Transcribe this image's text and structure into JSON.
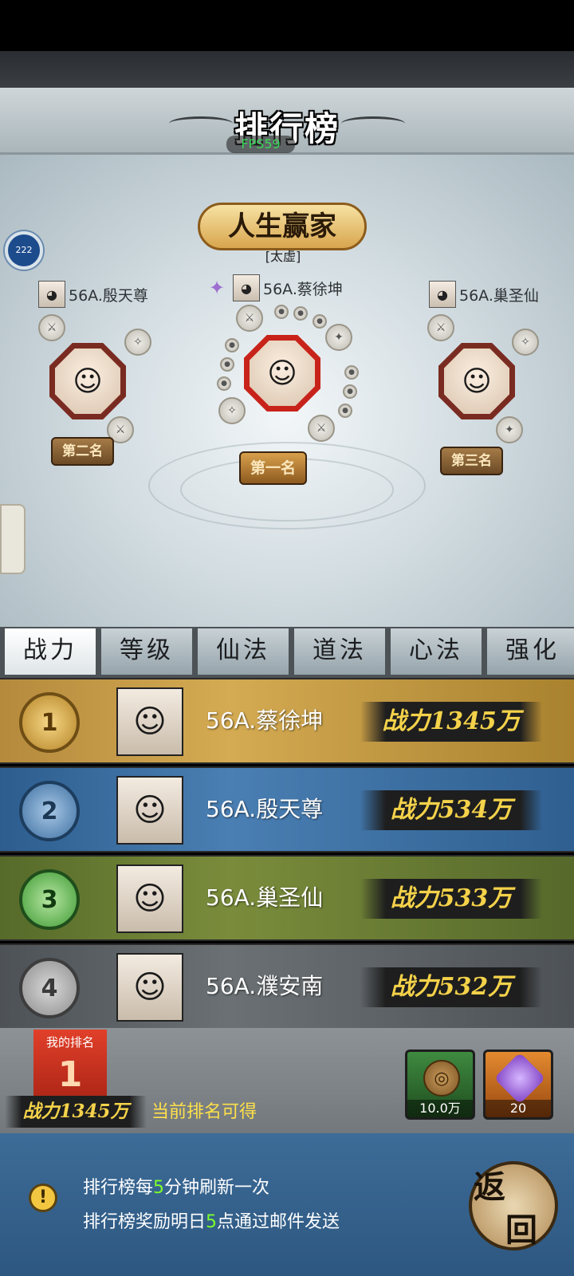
{
  "header": {
    "title": "排行榜",
    "fps": "FPS59"
  },
  "floating_ball": {
    "label": "222"
  },
  "podium": {
    "banner": "人生赢家",
    "subtitle": "[太虚]",
    "first": {
      "name": "56A.蔡徐坤",
      "badge": "第一名"
    },
    "second": {
      "name": "56A.殷天尊",
      "badge": "第二名"
    },
    "third": {
      "name": "56A.巢圣仙",
      "badge": "第三名"
    }
  },
  "tabs": [
    {
      "label": "战力",
      "active": true
    },
    {
      "label": "等级"
    },
    {
      "label": "仙法"
    },
    {
      "label": "道法"
    },
    {
      "label": "心法"
    },
    {
      "label": "强化"
    }
  ],
  "ranking": [
    {
      "rank": "1",
      "name": "56A.蔡徐坤",
      "power": "战力1345万"
    },
    {
      "rank": "2",
      "name": "56A.殷天尊",
      "power": "战力534万"
    },
    {
      "rank": "3",
      "name": "56A.巢圣仙",
      "power": "战力533万"
    },
    {
      "rank": "4",
      "name": "56A.濮安南",
      "power": "战力532万"
    }
  ],
  "my_rank": {
    "label": "我的排名",
    "rank": "1",
    "power": "战力1345万",
    "reward_text": "当前排名可得",
    "rewards": [
      {
        "icon": "copper-coin-icon",
        "count": "10.0万"
      },
      {
        "icon": "purple-gem-icon",
        "count": "20"
      }
    ]
  },
  "info": {
    "line1": {
      "a": "排行榜每",
      "n": "5",
      "b": "分钟刷新一次"
    },
    "line2": {
      "a": "排行榜奖励明日",
      "n": "5",
      "b": "点通过邮件发送"
    }
  },
  "return_button": {
    "c1": "返",
    "c2": "回"
  }
}
